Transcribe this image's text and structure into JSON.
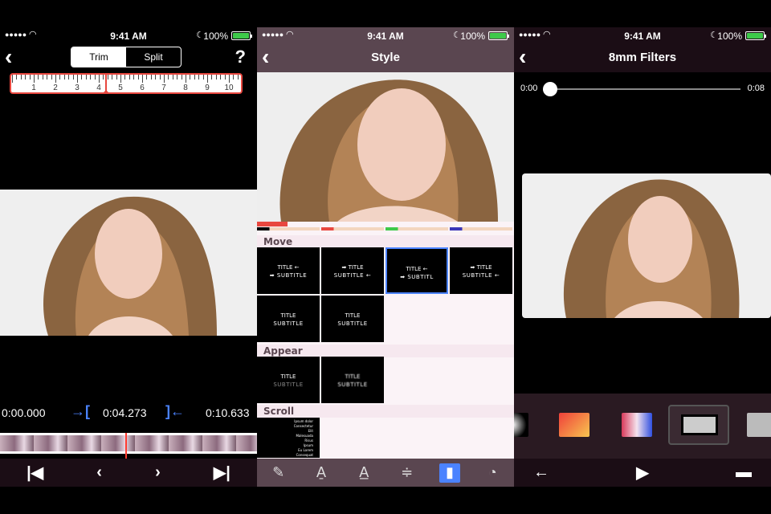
{
  "status": {
    "signal": "●●●●●",
    "time": "9:41 AM",
    "battery": "100%"
  },
  "trim_screen": {
    "back": "‹",
    "tabs": [
      "Trim",
      "Split"
    ],
    "active_tab": "Trim",
    "help": "?",
    "ruler_labels": [
      "1",
      "2",
      "3",
      "4",
      "5",
      "6",
      "7",
      "8",
      "9",
      "10"
    ],
    "start_time": "0:00.000",
    "current_time": "0:04.273",
    "end_time": "0:10.633",
    "bracket_left": "→[",
    "bracket_right": "]←",
    "toolbar": [
      "|◀",
      "‹",
      "›",
      "▶|"
    ]
  },
  "style_screen": {
    "back": "‹",
    "title": "Style",
    "sections": {
      "move": "Move",
      "appear": "Appear",
      "scroll": "Scroll"
    },
    "thumb_title": "TITLE",
    "thumb_subtitle": "SUBTITLE",
    "move_thumbs": [
      {
        "title": "TITLE ←",
        "subtitle": "➡ SUBTITLE"
      },
      {
        "title": "➡ TITLE",
        "subtitle": "SUBTITLE ←"
      },
      {
        "title": "TITLE ←",
        "subtitle": "➡ SUBTITL"
      },
      {
        "title": "➡ TITLE",
        "subtitle": "SUBTITLE ←"
      },
      {
        "title": "TITLE",
        "subtitle": "SUBTITLE"
      },
      {
        "title": "TITLE",
        "subtitle": "SUBTITLE"
      }
    ],
    "appear_thumbs": [
      {
        "title": "TITLE",
        "subtitle": "SUBTITLE"
      },
      {
        "title": "TITLE",
        "subtitle": "SUBTITLE"
      }
    ],
    "scroll_lines": [
      "Ipsum dolor",
      "Consectetur",
      "Elit",
      "Malesuada",
      "Risus",
      "Ipsum",
      "Eu Lorem",
      "Consequat"
    ]
  },
  "filters_screen": {
    "back": "‹",
    "title": "8mm Filters",
    "start_time": "0:00",
    "end_time": "0:08",
    "playhead_fraction": 0.0,
    "toolbar": [
      "←",
      "▶",
      "▬"
    ]
  }
}
